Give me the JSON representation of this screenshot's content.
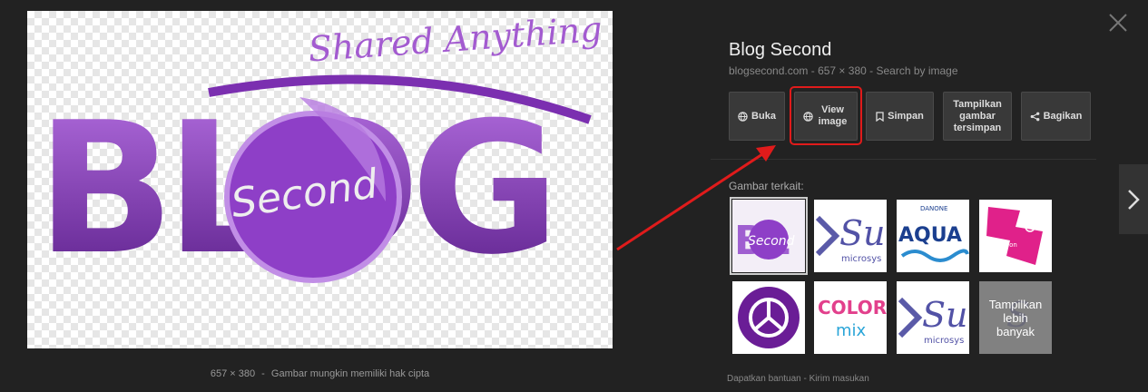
{
  "preview": {
    "image_logo_text": {
      "tagline": "Shared Anything",
      "word": "BLOG",
      "badge": "Second"
    },
    "caption": {
      "size": "657 × 380",
      "separator": "-",
      "copyright": "Gambar mungkin memiliki hak cipta"
    }
  },
  "details": {
    "title": "Blog Second",
    "meta": {
      "domain": "blogsecond.com",
      "sep1": "-",
      "size": "657 × 380",
      "sep2": "-",
      "search": "Search by image"
    },
    "actions": [
      {
        "label": "Buka",
        "icon": "globe-icon"
      },
      {
        "label": "View image",
        "icon": "globe-icon"
      },
      {
        "label": "Simpan",
        "icon": "bookmark-icon"
      },
      {
        "label": "Tampilkan gambar tersimpan",
        "icon": ""
      },
      {
        "label": "Bagikan",
        "icon": "share-icon"
      }
    ],
    "related_title": "Gambar terkait:",
    "related": [
      {
        "logo_text": "Second"
      },
      {
        "logo_text": "Su",
        "sub": "microsys"
      },
      {
        "logo_text": "AQUA",
        "brand": "DANONE"
      },
      {
        "logo_text": "london"
      },
      {
        "logo_text": ""
      },
      {
        "logo_text": "COLOR",
        "sub": "mix"
      },
      {
        "logo_text": "Su",
        "sub": "microsys"
      },
      {
        "logo_text": "Tampilkan lebih banyak"
      }
    ],
    "footer": {
      "help": "Dapatkan bantuan",
      "sep": "-",
      "feedback": "Kirim masukan"
    }
  },
  "colors": {
    "background": "#222222",
    "purple": "#8e3fc7",
    "highlight": "#e01b1b"
  }
}
